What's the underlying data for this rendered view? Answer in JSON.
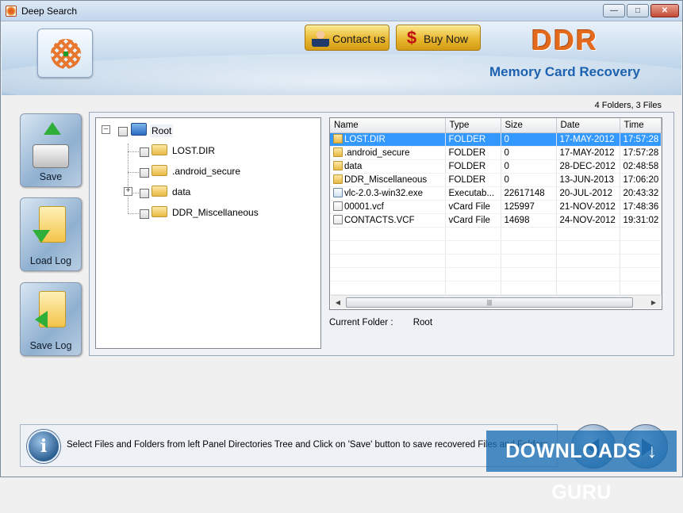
{
  "window": {
    "title": "Deep Search"
  },
  "header": {
    "contact_label": "Contact us",
    "buy_label": "Buy Now",
    "brand": "DDR",
    "subtitle": "Memory Card Recovery"
  },
  "summary": "4 Folders, 3 Files",
  "sidebar": {
    "save_label": "Save",
    "load_log_label": "Load Log",
    "save_log_label": "Save Log"
  },
  "tree": {
    "root": "Root",
    "children": [
      "LOST.DIR",
      ".android_secure",
      "data",
      "DDR_Miscellaneous"
    ]
  },
  "filelist": {
    "columns": [
      "Name",
      "Type",
      "Size",
      "Date",
      "Time"
    ],
    "rows": [
      {
        "name": "LOST.DIR",
        "type": "FOLDER",
        "size": "0",
        "date": "17-MAY-2012",
        "time": "17:57:28",
        "icon": "folder-icon"
      },
      {
        "name": ".android_secure",
        "type": "FOLDER",
        "size": "0",
        "date": "17-MAY-2012",
        "time": "17:57:28",
        "icon": "folder-icon"
      },
      {
        "name": "data",
        "type": "FOLDER",
        "size": "0",
        "date": "28-DEC-2012",
        "time": "02:48:58",
        "icon": "folder-icon"
      },
      {
        "name": "DDR_Miscellaneous",
        "type": "FOLDER",
        "size": "0",
        "date": "13-JUN-2013",
        "time": "17:06:20",
        "icon": "folder-icon"
      },
      {
        "name": "vlc-2.0.3-win32.exe",
        "type": "Executab...",
        "size": "22617148",
        "date": "20-JUL-2012",
        "time": "20:43:32",
        "icon": "exe-icon"
      },
      {
        "name": "00001.vcf",
        "type": "vCard File",
        "size": "125997",
        "date": "21-NOV-2012",
        "time": "17:48:36",
        "icon": "vcard-icon"
      },
      {
        "name": "CONTACTS.VCF",
        "type": "vCard File",
        "size": "14698",
        "date": "24-NOV-2012",
        "time": "19:31:02",
        "icon": "vcard-icon"
      }
    ]
  },
  "current_folder": {
    "label": "Current Folder :",
    "value": "Root"
  },
  "status": {
    "message": "Select Files and Folders from left Panel Directories Tree and Click on 'Save' button to save recovered Files and Folders."
  },
  "watermark": "DOWNLOADS ↓ GURU",
  "colors": {
    "brand": "#e36a1c",
    "subtitle": "#1d62b0",
    "selection": "#3399ff"
  }
}
